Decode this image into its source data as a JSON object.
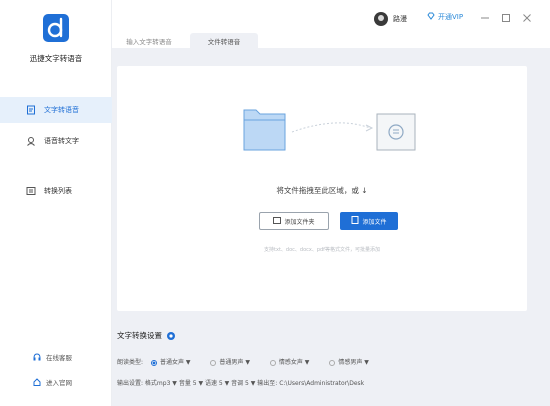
{
  "app": {
    "name": "迅捷文字转语音"
  },
  "sidebar": {
    "items": [
      {
        "label": "文字转语音",
        "icon": "text-doc-icon",
        "active": true
      },
      {
        "label": "语音转文字",
        "icon": "voice-icon",
        "active": false
      },
      {
        "label": "转换列表",
        "icon": "list-icon",
        "active": false
      }
    ],
    "bottom": [
      {
        "label": "在线客服",
        "icon": "headset-icon"
      },
      {
        "label": "进入官网",
        "icon": "home-icon"
      }
    ]
  },
  "tabs": [
    {
      "label": "输入文字转语音",
      "active": false
    },
    {
      "label": "文件转语音",
      "active": true
    }
  ],
  "user": {
    "name": "路漫"
  },
  "vip": {
    "label": "开通VIP"
  },
  "dropzone": {
    "text": "将文件拖拽至此区域，或 ↓",
    "btn_folder": "添加文件夹",
    "btn_file": "添加文件",
    "hint": "支持txt、doc、docx、pdf等格式文件，可批量添加"
  },
  "settings": {
    "title": "文字转换设置",
    "row1_label": "朗读类型:",
    "row1_options": [
      "普通女声 ▼",
      "普通男声 ▼",
      "情感女声 ▼",
      "情感男声 ▼"
    ],
    "row2": "输出设置:  格式mp3  ▼    音量  5  ▼    语速  5  ▼    音调  5  ▼    输出至: C:\\Users\\Administrator\\Desk"
  },
  "colors": {
    "accent": "#1f6fd6",
    "folder": "#bcd8f5",
    "bg": "#eef0f5"
  }
}
